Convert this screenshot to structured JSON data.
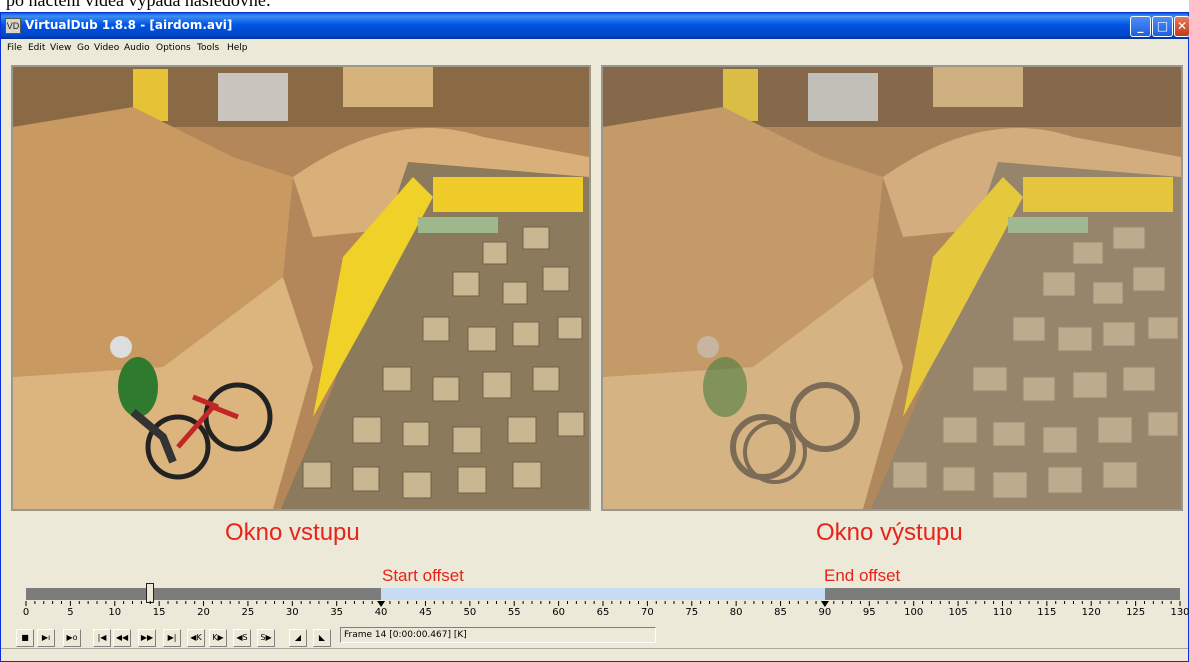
{
  "caption": "po načtení videa vypadá následovně:",
  "window": {
    "title": "VirtualDub 1.8.8 - [airdom.avi]",
    "icon_text": "VD",
    "buttons": {
      "minimize": "_",
      "maximize": "□",
      "close": "✕"
    }
  },
  "menu": [
    "File",
    "Edit",
    "View",
    "Go",
    "Video",
    "Audio",
    "Options",
    "Tools",
    "Help"
  ],
  "annotations": {
    "input_window": "Okno vstupu",
    "output_window": "Okno výstupu",
    "start_offset": "Start offset",
    "end_offset": "End offset"
  },
  "timeline": {
    "min": 0,
    "max": 130,
    "tick_labels": [
      "0",
      "5",
      "10",
      "15",
      "20",
      "25",
      "30",
      "35",
      "40",
      "45",
      "50",
      "55",
      "60",
      "65",
      "70",
      "75",
      "80",
      "85",
      "90",
      "95",
      "100",
      "105",
      "110",
      "115",
      "120",
      "125",
      "130"
    ],
    "current_frame": 14,
    "selection_start": 40,
    "selection_end": 90
  },
  "toolbar": {
    "buttons": [
      {
        "name": "stop-button",
        "glyph": "■"
      },
      {
        "name": "play-input-button",
        "glyph": "▶ı"
      },
      {
        "name": "play-output-button",
        "glyph": "▶o"
      },
      {
        "name": "go-start-button",
        "glyph": "|◀"
      },
      {
        "name": "prev-frame-button",
        "glyph": "◀◀"
      },
      {
        "name": "next-frame-button",
        "glyph": "▶▶"
      },
      {
        "name": "go-end-button",
        "glyph": "▶|"
      },
      {
        "name": "prev-key-button",
        "glyph": "◀K"
      },
      {
        "name": "next-key-button",
        "glyph": "K▶"
      },
      {
        "name": "prev-scene-button",
        "glyph": "◀S"
      },
      {
        "name": "next-scene-button",
        "glyph": "S▶"
      },
      {
        "name": "mark-in-button",
        "glyph": "◢"
      },
      {
        "name": "mark-out-button",
        "glyph": "◣"
      }
    ],
    "status": "Frame 14 [0:00:00.467] [K]"
  },
  "colors": {
    "annotation": "#e8231a",
    "selection": "#c6dcf2",
    "track": "#7c7c7c",
    "title_bar": "#0054e3"
  }
}
